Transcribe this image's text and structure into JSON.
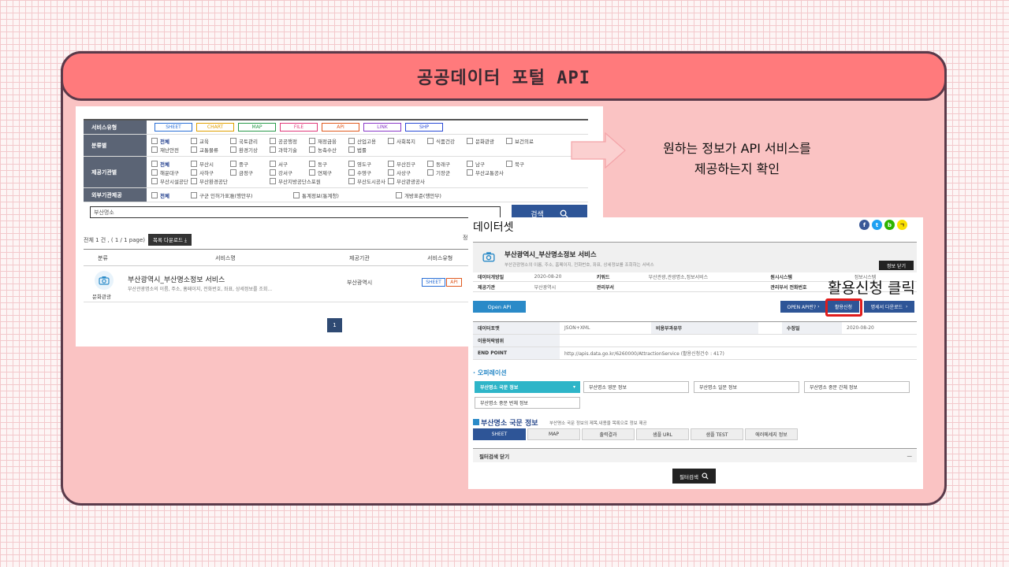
{
  "slide": {
    "title": "공공데이터 포털 API"
  },
  "callout": {
    "line1": "원하는 정보가 API 서비스를",
    "line2": "제공하는지 확인"
  },
  "highlight": {
    "label": "활용신청 클릭"
  },
  "search_page": {
    "filters": {
      "service_type": {
        "label": "서비스유형",
        "tags": [
          {
            "text": "SHEET",
            "color": "#2a6fd6"
          },
          {
            "text": "CHART",
            "color": "#e0a000"
          },
          {
            "text": "MAP",
            "color": "#2a9a4a"
          },
          {
            "text": "FILE",
            "color": "#e03a7a"
          },
          {
            "text": "API",
            "color": "#e05a20"
          },
          {
            "text": "LINK",
            "color": "#8a3ac8"
          },
          {
            "text": "SHP",
            "color": "#2a4ad6"
          }
        ]
      },
      "category": {
        "label": "분류별",
        "items": [
          "전체",
          "교육",
          "국토관리",
          "공공행정",
          "재정금융",
          "산업고용",
          "사회복지",
          "식품건강",
          "문화관광",
          "보건의료",
          "재난안전",
          "교통물류",
          "환경기상",
          "과학기술",
          "농축수산",
          "법률"
        ]
      },
      "provider": {
        "label": "제공기관별",
        "items": [
          "전체",
          "부산시",
          "중구",
          "서구",
          "동구",
          "영도구",
          "부산진구",
          "동래구",
          "남구",
          "북구",
          "해운대구",
          "사하구",
          "금정구",
          "강서구",
          "연제구",
          "수영구",
          "사상구",
          "기장군",
          "부산교통공사",
          "부산시설공단",
          "부산환경공단",
          "부산지방공단스포원",
          "부산도시공사",
          "부산관광공사"
        ]
      },
      "external": {
        "label": "외부기관제공",
        "items": [
          "전체",
          "구군 인허가표准(행안부)",
          "통계정보(통계청)",
          "개방표준(행안부)"
        ]
      }
    },
    "search": {
      "value": "부산명소",
      "button": "검색"
    },
    "result_count": "전체 1 건 , ( 1 / 1 page)",
    "download_button": "목록 다운로드",
    "pagination_hint": "정",
    "table": {
      "headers": [
        "분류",
        "서비스명",
        "제공기관",
        "서비스유형"
      ],
      "row": {
        "category": "문화관광",
        "name": "부산광역시_부산명소정보 서비스",
        "desc": "부산관광명소의 이름, 주소, 홈페이지, 전화번호, 좌표, 상세정보를 조회...",
        "provider": "부산광역시",
        "types": [
          "SHEET",
          "API"
        ]
      }
    },
    "page": "1"
  },
  "detail_page": {
    "heading": "데이터셋",
    "social": [
      "f",
      "t",
      "b",
      "ㄱ"
    ],
    "service": {
      "name": "부산광역시_부산명소정보 서비스",
      "desc": "부산관광명소의 이름, 주소, 홈페이지, 전화번호, 좌표, 상세정보를 조회하는 서비스",
      "close_button": "정보 닫기"
    },
    "meta": [
      {
        "k1": "데이터개방일",
        "v1": "2020-08-20",
        "k2": "키워드",
        "v2": "부산관광,관광명소,정보서비스",
        "k3": "원시시스템",
        "v3": "정보시스템"
      },
      {
        "k1": "제공기관",
        "v1": "부산광역시",
        "k2": "관리부서",
        "v2": "",
        "k3": "관리부서 전화번호",
        "v3": ""
      }
    ],
    "tab_open_api": "Open API",
    "buttons": {
      "what": "OPEN API란?",
      "apply": "활용신청",
      "spec": "명세서 다운로드"
    },
    "props": [
      {
        "k": "데이터포맷",
        "v": "JSON+XML",
        "k2": "비용부과유무",
        "v2": "",
        "k3": "수정일",
        "v3": "2020-08-20"
      },
      {
        "k": "이용허락범위",
        "v": ""
      },
      {
        "k": "END POINT",
        "v": "http://apis.data.go.kr/6260000/AttractionService (활용신청건수 : 417)"
      }
    ],
    "operations_title": "· 오퍼레이션",
    "operations": [
      "부산명소 국문 정보",
      "부산명소 영문 정보",
      "부산명소 일문 정보",
      "부산명소 중문 간체 정보",
      "부산명소 중문 번체 정보"
    ],
    "section_title": "부산명소 국문 정보",
    "section_desc": "부산명소 국문 정보의 제목,내용을 목록으로 정보 제공",
    "view_tabs": [
      "SHEET",
      "MAP",
      "출력결과",
      "샘플 URL",
      "샘플 TEST",
      "에러메세지 정보"
    ],
    "filter_label": "필터검색 닫기",
    "filter_button": "필터검색"
  }
}
